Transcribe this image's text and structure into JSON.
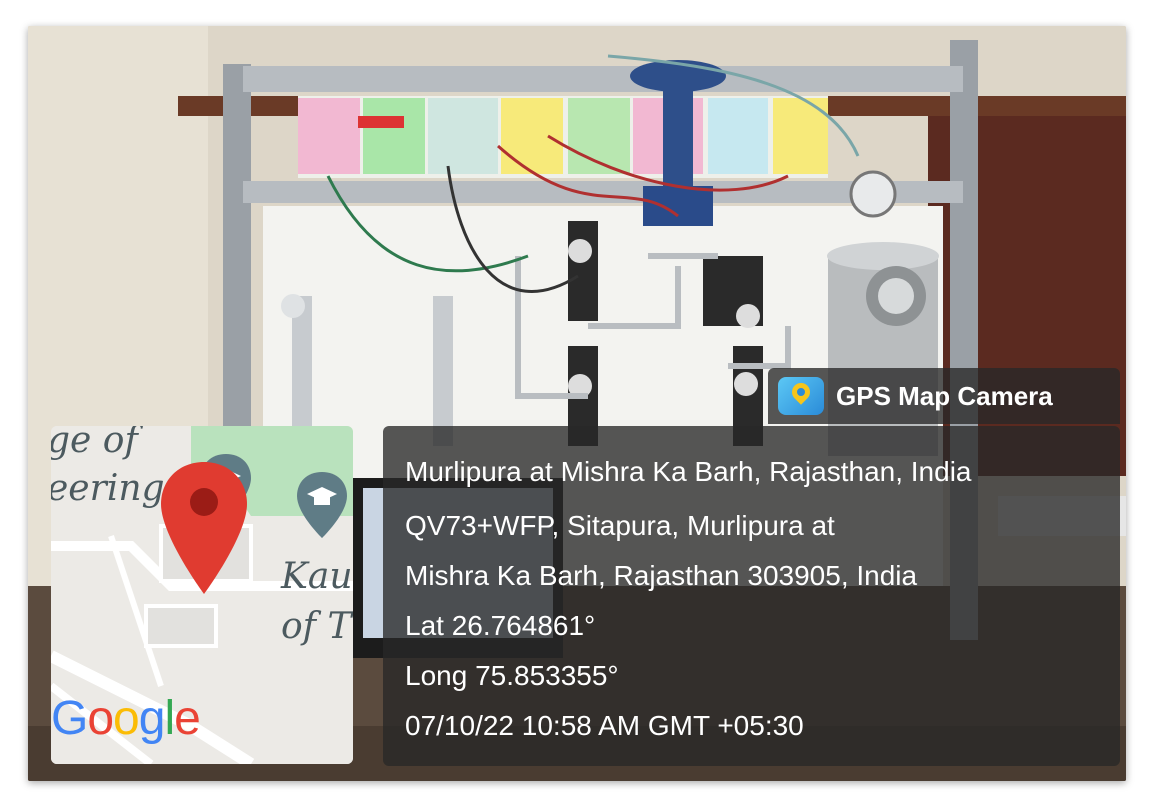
{
  "photo": {
    "description_icon": "lab-equipment-photo"
  },
  "gps_badge": {
    "icon": "gps-map-camera-icon",
    "label": "GPS Map Camera"
  },
  "location": {
    "line1": "Murlipura at Mishra Ka Barh, Rajasthan, India",
    "line2": "QV73+WFP, Sitapura, Murlipura at",
    "line3": "Mishra Ka Barh, Rajasthan 303905, India",
    "lat": "Lat 26.764861°",
    "long": "Long 75.853355°",
    "timestamp": "07/10/22 10:58 AM GMT +05:30"
  },
  "map": {
    "label_top": "ge of",
    "label_mid": "eering",
    "label_kau": "Kau",
    "label_of": "of T",
    "brand": "Google",
    "pin_icon": "location-pin-icon",
    "school_icon": "graduation-cap-icon",
    "colors": {
      "pin": "#e03b30",
      "park": "#b9e2bd",
      "poi": "#5f7c86"
    }
  }
}
